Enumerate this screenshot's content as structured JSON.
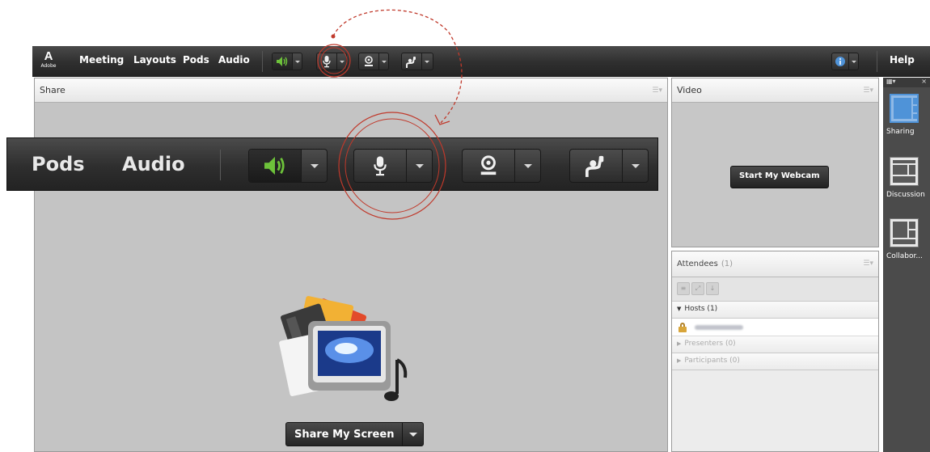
{
  "app": {
    "logo_text": "Adobe"
  },
  "menubar": {
    "items": [
      {
        "label": "Meeting"
      },
      {
        "label": "Layouts"
      },
      {
        "label": "Pods"
      },
      {
        "label": "Audio"
      }
    ],
    "help_label": "Help"
  },
  "zoom_toolbar": {
    "labels": [
      {
        "label": "Pods"
      },
      {
        "label": "Audio"
      }
    ]
  },
  "share_pod": {
    "title": "Share",
    "share_button_label": "Share My Screen"
  },
  "video_pod": {
    "title": "Video",
    "webcam_button_label": "Start My Webcam"
  },
  "attendees_pod": {
    "title": "Attendees",
    "count": "(1)",
    "groups": [
      {
        "label": "Hosts (1)"
      },
      {
        "label": "Presenters (0)"
      },
      {
        "label": "Participants (0)"
      }
    ]
  },
  "layouts": {
    "items": [
      {
        "label": "Sharing"
      },
      {
        "label": "Discussion"
      },
      {
        "label": "Collabor..."
      }
    ]
  },
  "colors": {
    "accent_green": "#6dc23a",
    "annotation_red": "#c0392b",
    "selected_layout_blue": "#4f93d8"
  },
  "icons": [
    "adobe-logo",
    "speaker-icon",
    "microphone-icon",
    "webcam-icon",
    "raise-hand-icon",
    "info-icon",
    "share-screen-icon",
    "lock-icon"
  ]
}
